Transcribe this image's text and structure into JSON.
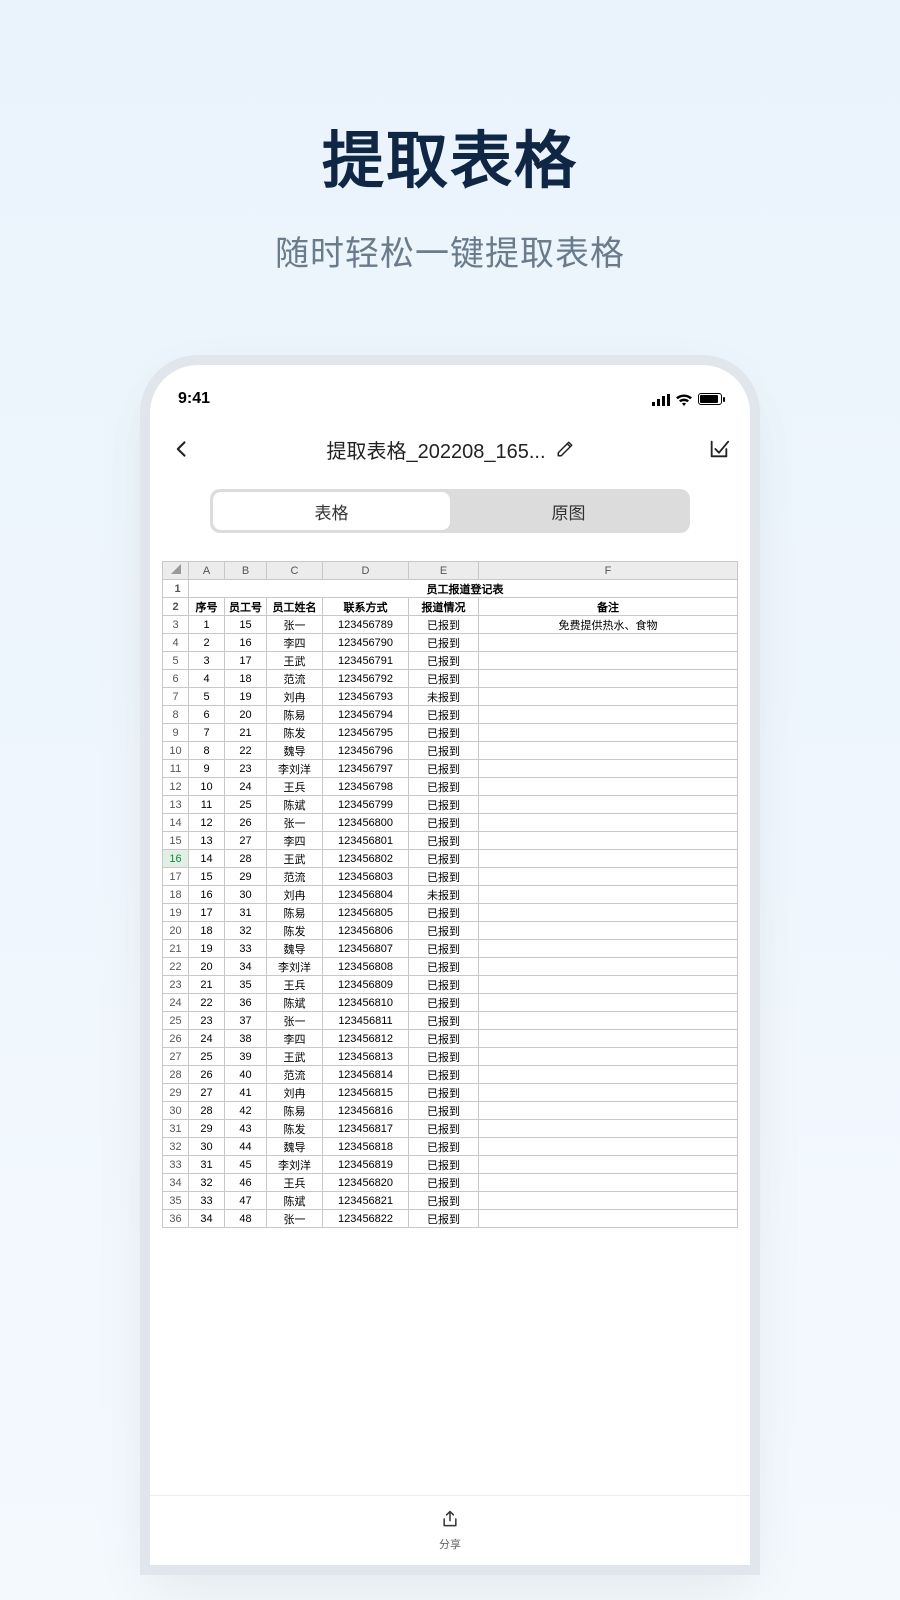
{
  "promo": {
    "title": "提取表格",
    "subtitle": "随时轻松一键提取表格"
  },
  "status": {
    "time": "9:41"
  },
  "header": {
    "title": "提取表格_202208_165..."
  },
  "segmented": {
    "tab1": "表格",
    "tab2": "原图"
  },
  "share_label": "分享",
  "sheet": {
    "col_letters": [
      "A",
      "B",
      "C",
      "D",
      "E",
      "F"
    ],
    "title_cell": "员工报道登记表",
    "headers": [
      "序号",
      "员工号",
      "员工姓名",
      "联系方式",
      "报道情况",
      "备注"
    ],
    "rows": [
      [
        "1",
        "15",
        "张一",
        "123456789",
        "已报到",
        "免费提供热水、食物"
      ],
      [
        "2",
        "16",
        "李四",
        "123456790",
        "已报到",
        ""
      ],
      [
        "3",
        "17",
        "王武",
        "123456791",
        "已报到",
        ""
      ],
      [
        "4",
        "18",
        "范流",
        "123456792",
        "已报到",
        ""
      ],
      [
        "5",
        "19",
        "刘冉",
        "123456793",
        "未报到",
        ""
      ],
      [
        "6",
        "20",
        "陈易",
        "123456794",
        "已报到",
        ""
      ],
      [
        "7",
        "21",
        "陈发",
        "123456795",
        "已报到",
        ""
      ],
      [
        "8",
        "22",
        "魏导",
        "123456796",
        "已报到",
        ""
      ],
      [
        "9",
        "23",
        "李刘洋",
        "123456797",
        "已报到",
        ""
      ],
      [
        "10",
        "24",
        "王兵",
        "123456798",
        "已报到",
        ""
      ],
      [
        "11",
        "25",
        "陈斌",
        "123456799",
        "已报到",
        ""
      ],
      [
        "12",
        "26",
        "张一",
        "123456800",
        "已报到",
        ""
      ],
      [
        "13",
        "27",
        "李四",
        "123456801",
        "已报到",
        ""
      ],
      [
        "14",
        "28",
        "王武",
        "123456802",
        "已报到",
        ""
      ],
      [
        "15",
        "29",
        "范流",
        "123456803",
        "已报到",
        ""
      ],
      [
        "16",
        "30",
        "刘冉",
        "123456804",
        "未报到",
        ""
      ],
      [
        "17",
        "31",
        "陈易",
        "123456805",
        "已报到",
        ""
      ],
      [
        "18",
        "32",
        "陈发",
        "123456806",
        "已报到",
        ""
      ],
      [
        "19",
        "33",
        "魏导",
        "123456807",
        "已报到",
        ""
      ],
      [
        "20",
        "34",
        "李刘洋",
        "123456808",
        "已报到",
        ""
      ],
      [
        "21",
        "35",
        "王兵",
        "123456809",
        "已报到",
        ""
      ],
      [
        "22",
        "36",
        "陈斌",
        "123456810",
        "已报到",
        ""
      ],
      [
        "23",
        "37",
        "张一",
        "123456811",
        "已报到",
        ""
      ],
      [
        "24",
        "38",
        "李四",
        "123456812",
        "已报到",
        ""
      ],
      [
        "25",
        "39",
        "王武",
        "123456813",
        "已报到",
        ""
      ],
      [
        "26",
        "40",
        "范流",
        "123456814",
        "已报到",
        ""
      ],
      [
        "27",
        "41",
        "刘冉",
        "123456815",
        "已报到",
        ""
      ],
      [
        "28",
        "42",
        "陈易",
        "123456816",
        "已报到",
        ""
      ],
      [
        "29",
        "43",
        "陈发",
        "123456817",
        "已报到",
        ""
      ],
      [
        "30",
        "44",
        "魏导",
        "123456818",
        "已报到",
        ""
      ],
      [
        "31",
        "45",
        "李刘洋",
        "123456819",
        "已报到",
        ""
      ],
      [
        "32",
        "46",
        "王兵",
        "123456820",
        "已报到",
        ""
      ],
      [
        "33",
        "47",
        "陈斌",
        "123456821",
        "已报到",
        ""
      ],
      [
        "34",
        "48",
        "张一",
        "123456822",
        "已报到",
        ""
      ]
    ],
    "selected_row_index": 13
  }
}
